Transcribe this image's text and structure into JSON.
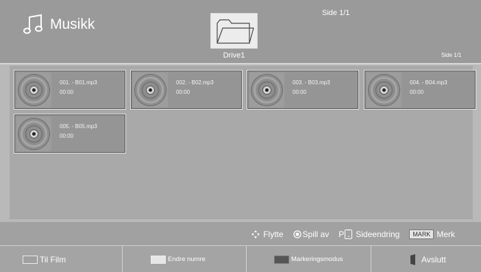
{
  "header": {
    "title": "Musikk",
    "page_indicator_top": "Side 1/1",
    "drive_label": "Drive1",
    "page_indicator_right": "Side 1/1"
  },
  "files": [
    {
      "name": "001. - B01.mp3",
      "duration": "00:00"
    },
    {
      "name": "002. - B02.mp3",
      "duration": "00:00"
    },
    {
      "name": "003. - B03.mp3",
      "duration": "00:00"
    },
    {
      "name": "004. - B04.mp3",
      "duration": "00:00"
    },
    {
      "name": "005. - B05.mp3",
      "duration": "00:00"
    }
  ],
  "hints": {
    "move": "Flytte",
    "play": "Spill av",
    "page_key": "P",
    "page_change": "Sideendring",
    "mark_key": "MARK",
    "mark": "Merk"
  },
  "footer": {
    "to_film": "Til Film",
    "change_number": "Endre numre",
    "mark_mode": "Markeringsmodus",
    "exit": "Avslutt"
  },
  "colors": {
    "background": "#b9b9b9",
    "header": "#9a9a9a",
    "panel": "#a9a9a9",
    "swatch_light": "#e6e6e6",
    "swatch_dark": "#555555"
  },
  "icons": {
    "title": "music-note-icon",
    "drive": "folder-icon",
    "tile": "disc-icon",
    "move": "dpad-arrows-icon",
    "play": "ok-circle-icon",
    "exit": "exit-door-icon"
  }
}
